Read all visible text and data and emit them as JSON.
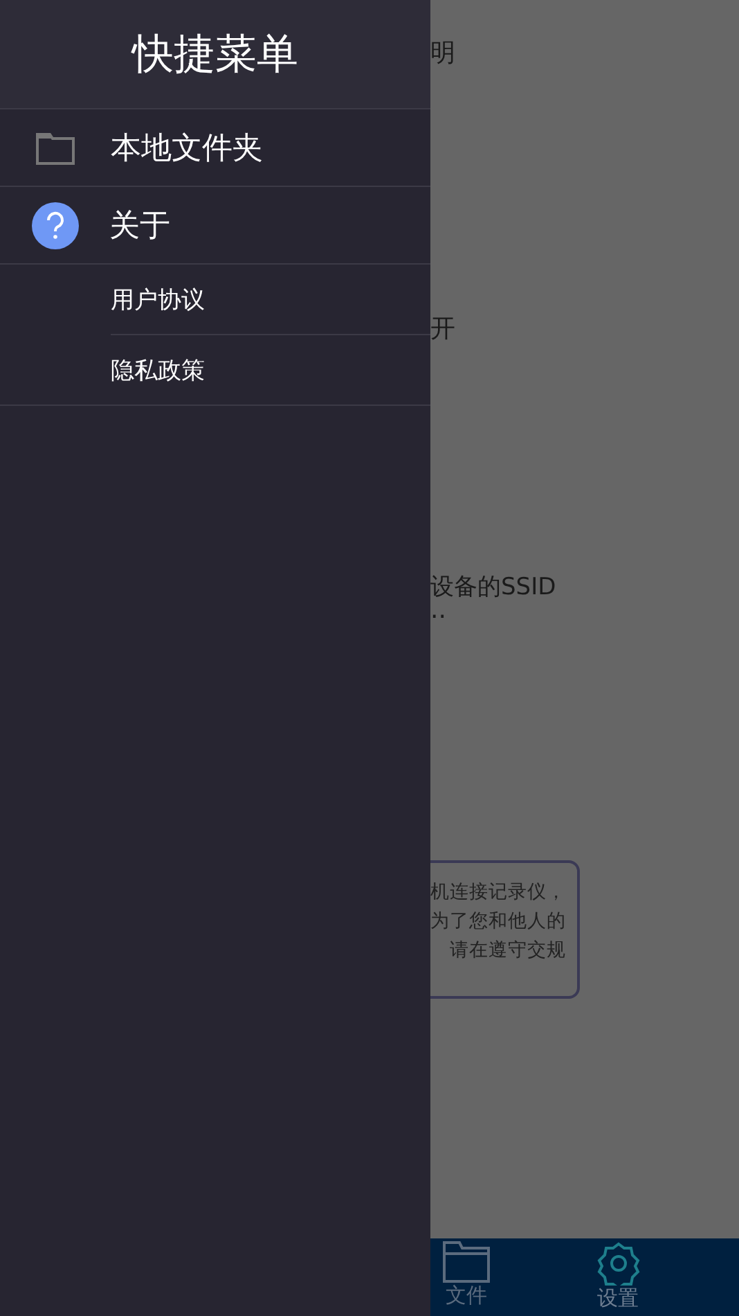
{
  "drawer": {
    "title": "快捷菜单",
    "items": [
      {
        "kind": "folder",
        "label": "本地文件夹"
      },
      {
        "kind": "help",
        "label": "关于"
      },
      {
        "kind": "sub",
        "label": "用户协议"
      },
      {
        "kind": "sub",
        "label": "隐私政策"
      }
    ]
  },
  "background": {
    "texts": [
      "明",
      "开",
      "设备的SSID",
      ".."
    ],
    "notice": [
      "机连接记录仪，",
      "为了您和他人的",
      "请在遵守交规"
    ]
  },
  "bottom_nav": [
    {
      "kind": "folder",
      "label": "文件",
      "selected": false
    },
    {
      "kind": "gear",
      "label": "设置",
      "selected": true
    }
  ]
}
